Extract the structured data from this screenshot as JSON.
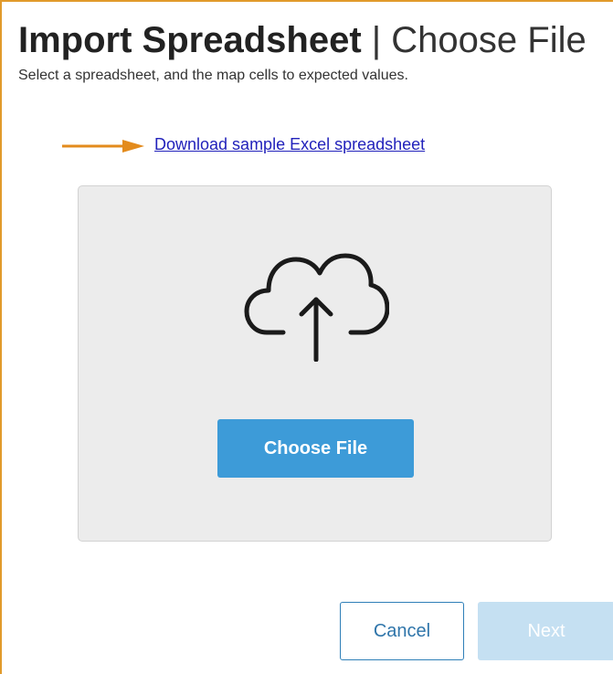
{
  "header": {
    "title_main": "Import Spreadsheet",
    "separator": "|",
    "title_step": "Choose File",
    "subtitle": "Select a spreadsheet, and the map cells to expected values."
  },
  "download": {
    "link_text": "Download sample Excel spreadsheet"
  },
  "dropzone": {
    "icon": "cloud-upload-icon",
    "choose_label": "Choose File"
  },
  "footer": {
    "cancel_label": "Cancel",
    "next_label": "Next",
    "next_state": "disabled"
  },
  "colors": {
    "frame_border": "#e19a2b",
    "arrow": "#e38b1d",
    "link": "#2222bb",
    "primary": "#3d9bd8",
    "primary_disabled": "#c5e0f2",
    "dropzone_bg": "#ececec"
  }
}
